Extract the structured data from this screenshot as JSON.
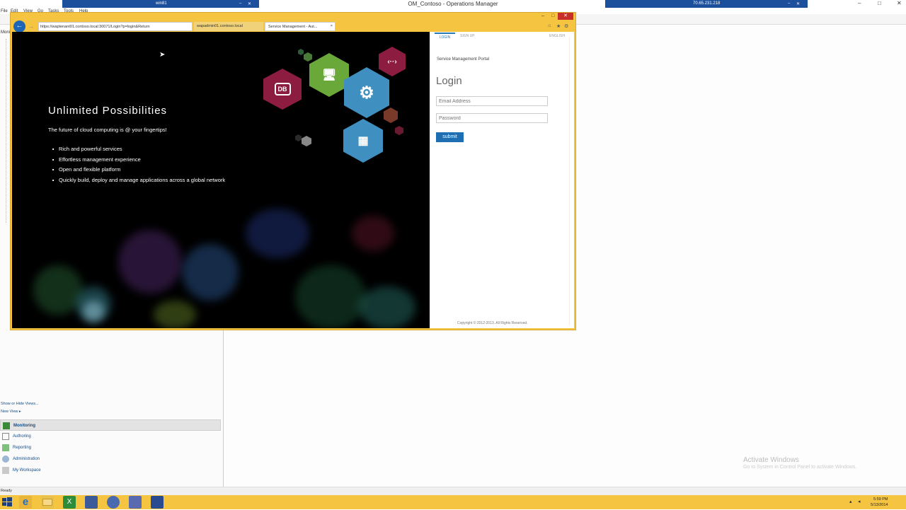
{
  "app": {
    "title": "OM_Contoso - Operations Manager",
    "menu": [
      "File",
      "Edit",
      "View",
      "Go",
      "Tasks",
      "Tools",
      "Help"
    ],
    "left_pane_header": "Monit",
    "show_hide_views": "Show or Hide Views...",
    "new_view": "New View ▸",
    "nav_buttons": [
      {
        "label": "Monitoring",
        "active": true
      },
      {
        "label": "Authoring",
        "active": false
      },
      {
        "label": "Reporting",
        "active": false
      },
      {
        "label": "Administration",
        "active": false
      },
      {
        "label": "My Workspace",
        "active": false
      }
    ],
    "status": "Ready"
  },
  "rdp": {
    "left_host": "win81",
    "right_host": "70.65.231.218"
  },
  "browser": {
    "url": "https://waptenant01.contoso.local:30071/Login?p=login&Return",
    "tabs": [
      {
        "label": "wapadmin01.contoso.local",
        "active": false
      },
      {
        "label": "Service Management - Aut...",
        "active": true
      }
    ],
    "close_tab": "×"
  },
  "hero": {
    "title": "Unlimited Possibilities",
    "subtitle": "The future of cloud computing is @ your fingertips!",
    "features": [
      "Rich and powerful services",
      "Effortless management experience",
      "Open and flexible platform",
      "Quickly build, deploy and manage applications across a global network"
    ],
    "db_label": "DB"
  },
  "login": {
    "tab_login": "LOGIN",
    "tab_signup": "SIGN UP",
    "language": "ENGLISH",
    "portal_label": "Service Management Portal",
    "heading": "Login",
    "email_placeholder": "Email Address",
    "password_placeholder": "Password",
    "submit_label": "submit",
    "copyright": "Copyright © 2012-2013. All Rights Reserved."
  },
  "watermark": {
    "line1": "Activate Windows",
    "line2": "Go to System in Control Panel to activate Windows."
  },
  "clock": {
    "time": "5:59 PM",
    "date": "5/13/2014"
  },
  "colors": {
    "taskbar": "#f5c542",
    "accent_blue": "#1d6fb2",
    "hex_green": "#6aa83a",
    "hex_blue": "#3f8fc0",
    "hex_maroon": "#8c1c40"
  }
}
